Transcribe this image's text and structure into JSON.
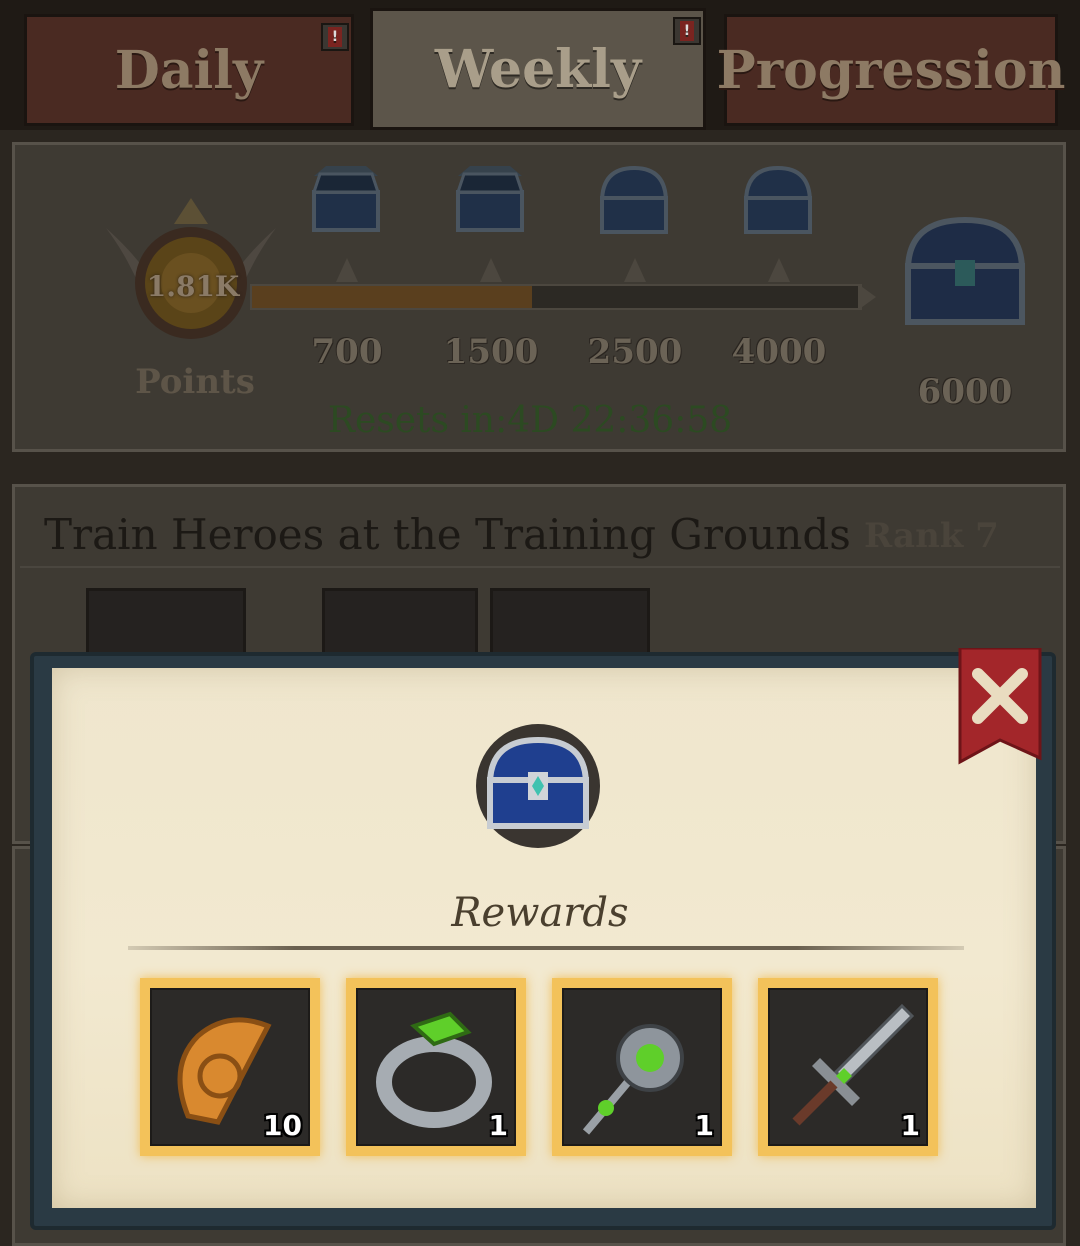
{
  "tabs": [
    {
      "label": "Daily",
      "has_alert": true
    },
    {
      "label": "Weekly",
      "has_alert": true,
      "active": true
    },
    {
      "label": "Progression",
      "has_alert": false
    }
  ],
  "points": {
    "value": "1.81K",
    "label": "Points",
    "progress_fraction": 0.46,
    "milestones": [
      "700",
      "1500",
      "2500",
      "4000"
    ],
    "final_milestone": "6000",
    "resets_label": "Resets in:4D 22:36:58"
  },
  "task": {
    "title": "Train Heroes at the Training Grounds",
    "rank": "Rank 7"
  },
  "modal": {
    "title": "Rewards",
    "rewards": [
      {
        "name": "gold-medal-shard-icon",
        "count": "10"
      },
      {
        "name": "emerald-ring-icon",
        "count": "1"
      },
      {
        "name": "emerald-mace-icon",
        "count": "1"
      },
      {
        "name": "emerald-sword-icon",
        "count": "1"
      }
    ]
  },
  "colors": {
    "reward_border": "#f3c25a",
    "close_ribbon": "#a3262a",
    "chest_blue": "#1f3f8f",
    "resets_text": "#2c4a22"
  }
}
